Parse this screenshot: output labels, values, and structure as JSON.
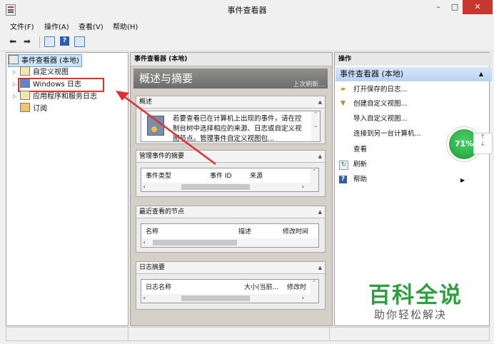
{
  "window": {
    "title": "事件查看器",
    "min": "–",
    "max": "□",
    "close": "✕"
  },
  "menu": [
    "文件(F)",
    "操作(A)",
    "查看(V)",
    "帮助(H)"
  ],
  "toolbar": {
    "back": "⬅",
    "forward": "➡",
    "help": "?"
  },
  "tree": {
    "root": "事件查看器 (本地)",
    "items": [
      "自定义视图",
      "Windows 日志",
      "应用程序和服务日志",
      "订阅"
    ]
  },
  "middle": {
    "header": "事件查看器 (本地)",
    "overview_title": "概述与摘要",
    "last_refresh": "上次刷新...",
    "sections": [
      {
        "title": "概述",
        "text": "若要查看已在计算机上出现的事件，请在控制台树中选择相应的来源、日志或自定义视图节点。管理事件自定义视图包..."
      },
      {
        "title": "管理事件的摘要",
        "columns": [
          "事件类型",
          "事件 ID",
          "来源"
        ]
      },
      {
        "title": "最近查看的节点",
        "columns": [
          "名称",
          "描述",
          "修改时间"
        ]
      },
      {
        "title": "日志摘要",
        "columns": [
          "日志名称",
          "大小(当前...",
          "修改时"
        ]
      }
    ]
  },
  "actions": {
    "header": "操作",
    "group": "事件查看器 (本地)",
    "items": [
      "打开保存的日志...",
      "创建自定义视图...",
      "导入自定义视图...",
      "连接到另一台计算机...",
      "查看",
      "刷新",
      "帮助"
    ]
  },
  "badge": {
    "percent": "71%",
    "up": "↑",
    "down": "↓"
  },
  "watermark": {
    "line1": "百科全说",
    "line2": "助你轻松解决"
  },
  "colors": {
    "accent": "#2ea043",
    "highlight_box": "#e03030",
    "action_group": "#c6dbf5"
  }
}
